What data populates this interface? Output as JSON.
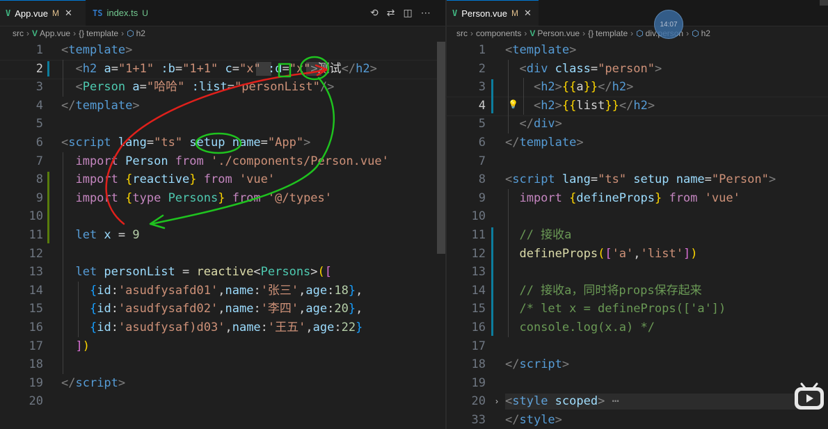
{
  "left": {
    "tabs": [
      {
        "icon": "V",
        "name": "App.vue",
        "mark": "M",
        "close": "✕",
        "active": true
      },
      {
        "icon": "TS",
        "name": "index.ts",
        "mark": "U",
        "active": false
      }
    ],
    "breadcrumb": [
      "src",
      "App.vue",
      "template",
      "h2"
    ],
    "lines": [
      {
        "n": "1",
        "t": [
          [
            "t-p",
            "<"
          ],
          [
            "t-tag",
            "template"
          ],
          [
            "t-p",
            ">"
          ]
        ]
      },
      {
        "n": "2",
        "cur": true,
        "t": [
          [
            "t-p",
            "  <"
          ],
          [
            "t-tag",
            "h2"
          ],
          [
            "",
            ""
          ],
          [
            "t-attr",
            " a"
          ],
          [
            "",
            "="
          ],
          [
            "t-str",
            "\"1+1\""
          ],
          [
            "t-attr",
            " :b"
          ],
          [
            "",
            "="
          ],
          [
            "t-str",
            "\"1+1\""
          ],
          [
            "t-attr",
            " c"
          ],
          [
            "",
            "="
          ],
          [
            "t-str",
            "\"x\""
          ],
          [
            "t-attr",
            " :d"
          ],
          [
            "",
            "="
          ],
          [
            "t-str",
            "\"x\""
          ],
          [
            "t-p",
            ">"
          ],
          [
            "",
            "测试"
          ],
          [
            "t-p",
            "</"
          ],
          [
            "t-tag",
            "h2"
          ],
          [
            "t-p",
            ">"
          ]
        ]
      },
      {
        "n": "3",
        "t": [
          [
            "t-p",
            "  <"
          ],
          [
            "t-comp",
            "Person"
          ],
          [
            "t-attr",
            " a"
          ],
          [
            "",
            "="
          ],
          [
            "t-str",
            "\"哈哈\""
          ],
          [
            "t-attr",
            " :list"
          ],
          [
            "",
            "="
          ],
          [
            "t-str",
            "\"personList\""
          ],
          [
            "t-p",
            "/>"
          ]
        ]
      },
      {
        "n": "4",
        "t": [
          [
            "t-p",
            "</"
          ],
          [
            "t-tag",
            "template"
          ],
          [
            "t-p",
            ">"
          ]
        ]
      },
      {
        "n": "5",
        "t": []
      },
      {
        "n": "6",
        "t": [
          [
            "t-p",
            "<"
          ],
          [
            "t-tag",
            "script"
          ],
          [
            "t-attr",
            " lang"
          ],
          [
            "",
            "="
          ],
          [
            "t-str",
            "\"ts\""
          ],
          [
            "t-attr",
            " setup"
          ],
          [
            "t-attr",
            " name"
          ],
          [
            "",
            "="
          ],
          [
            "t-str",
            "\"App\""
          ],
          [
            "t-p",
            ">"
          ]
        ]
      },
      {
        "n": "7",
        "t": [
          [
            "t-kw",
            "  import"
          ],
          [
            "",
            " "
          ],
          [
            "t-var",
            "Person"
          ],
          [
            "t-kw",
            " from"
          ],
          [
            "t-str",
            " './components/Person.vue'"
          ]
        ]
      },
      {
        "n": "8",
        "t": [
          [
            "t-kw",
            "  import"
          ],
          [
            "t-br1",
            " {"
          ],
          [
            "t-var",
            "reactive"
          ],
          [
            "t-br1",
            "}"
          ],
          [
            "t-kw",
            " from"
          ],
          [
            "t-str",
            " 'vue'"
          ]
        ]
      },
      {
        "n": "9",
        "t": [
          [
            "t-kw",
            "  import"
          ],
          [
            "t-br1",
            " {"
          ],
          [
            "t-kw",
            "type"
          ],
          [
            "t-comp",
            " Persons"
          ],
          [
            "t-br1",
            "}"
          ],
          [
            "t-kw",
            " from"
          ],
          [
            "t-str",
            " '@/types'"
          ]
        ]
      },
      {
        "n": "10",
        "t": []
      },
      {
        "n": "11",
        "t": [
          [
            "t-tag",
            "  let"
          ],
          [
            "t-var",
            " x"
          ],
          [
            "",
            " = "
          ],
          [
            "t-num",
            "9"
          ]
        ]
      },
      {
        "n": "12",
        "t": []
      },
      {
        "n": "13",
        "t": [
          [
            "t-tag",
            "  let"
          ],
          [
            "t-var",
            " personList"
          ],
          [
            "",
            " = "
          ],
          [
            "t-fn",
            "reactive"
          ],
          [
            "",
            "<"
          ],
          [
            "t-comp",
            "Persons"
          ],
          [
            "",
            ">"
          ],
          [
            "t-br1",
            "("
          ],
          [
            "t-br2",
            "["
          ]
        ]
      },
      {
        "n": "14",
        "t": [
          [
            "",
            "    "
          ],
          [
            "t-br3",
            "{"
          ],
          [
            "t-var",
            "id"
          ],
          [
            "",
            ":"
          ],
          [
            "t-str",
            "'asudfysafd01'"
          ],
          [
            "",
            ","
          ],
          [
            "t-var",
            "name"
          ],
          [
            "",
            ":"
          ],
          [
            "t-str",
            "'张三'"
          ],
          [
            "",
            ","
          ],
          [
            "t-var",
            "age"
          ],
          [
            "",
            ":"
          ],
          [
            "t-num",
            "18"
          ],
          [
            "t-br3",
            "}"
          ],
          [
            "",
            ","
          ]
        ]
      },
      {
        "n": "15",
        "t": [
          [
            "",
            "    "
          ],
          [
            "t-br3",
            "{"
          ],
          [
            "t-var",
            "id"
          ],
          [
            "",
            ":"
          ],
          [
            "t-str",
            "'asudfysafd02'"
          ],
          [
            "",
            ","
          ],
          [
            "t-var",
            "name"
          ],
          [
            "",
            ":"
          ],
          [
            "t-str",
            "'李四'"
          ],
          [
            "",
            ","
          ],
          [
            "t-var",
            "age"
          ],
          [
            "",
            ":"
          ],
          [
            "t-num",
            "20"
          ],
          [
            "t-br3",
            "}"
          ],
          [
            "",
            ","
          ]
        ]
      },
      {
        "n": "16",
        "t": [
          [
            "",
            "    "
          ],
          [
            "t-br3",
            "{"
          ],
          [
            "t-var",
            "id"
          ],
          [
            "",
            ":"
          ],
          [
            "t-str",
            "'asudfysaf)d03'"
          ],
          [
            "",
            ","
          ],
          [
            "t-var",
            "name"
          ],
          [
            "",
            ":"
          ],
          [
            "t-str",
            "'王五'"
          ],
          [
            "",
            ","
          ],
          [
            "t-var",
            "age"
          ],
          [
            "",
            ":"
          ],
          [
            "t-num",
            "22"
          ],
          [
            "t-br3",
            "}"
          ]
        ]
      },
      {
        "n": "17",
        "t": [
          [
            "t-br2",
            "  ]"
          ],
          [
            "t-br1",
            ")"
          ]
        ]
      },
      {
        "n": "18",
        "t": []
      },
      {
        "n": "19",
        "t": [
          [
            "t-p",
            "</"
          ],
          [
            "t-tag",
            "script"
          ],
          [
            "t-p",
            ">"
          ]
        ]
      },
      {
        "n": "20",
        "t": []
      }
    ]
  },
  "right": {
    "tabs": [
      {
        "icon": "V",
        "name": "Person.vue",
        "mark": "M",
        "close": "✕",
        "active": true
      }
    ],
    "breadcrumb": [
      "src",
      "components",
      "Person.vue",
      "template",
      "div.person",
      "h2"
    ],
    "clock": "14:07",
    "lines": [
      {
        "n": "1",
        "t": [
          [
            "t-p",
            "<"
          ],
          [
            "t-tag",
            "template"
          ],
          [
            "t-p",
            ">"
          ]
        ]
      },
      {
        "n": "2",
        "t": [
          [
            "t-p",
            "  <"
          ],
          [
            "t-tag",
            "div"
          ],
          [
            "t-attr",
            " class"
          ],
          [
            "",
            "="
          ],
          [
            "t-str",
            "\"person\""
          ],
          [
            "t-p",
            ">"
          ]
        ]
      },
      {
        "n": "3",
        "t": [
          [
            "t-p",
            "    <"
          ],
          [
            "t-tag",
            "h2"
          ],
          [
            "t-p",
            ">"
          ],
          [
            "t-br1",
            "{{"
          ],
          [
            "",
            "a"
          ],
          [
            "t-br1",
            "}}"
          ],
          [
            "t-p",
            "</"
          ],
          [
            "t-tag",
            "h2"
          ],
          [
            "t-p",
            ">"
          ]
        ]
      },
      {
        "n": "4",
        "cur": true,
        "t": [
          [
            "t-p",
            "    <"
          ],
          [
            "t-tag",
            "h2"
          ],
          [
            "t-p",
            ">"
          ],
          [
            "t-br1",
            "{{"
          ],
          [
            "",
            "list"
          ],
          [
            "t-br1",
            "}}"
          ],
          [
            "t-p",
            "</"
          ],
          [
            "t-tag",
            "h2"
          ],
          [
            "t-p",
            ">"
          ]
        ]
      },
      {
        "n": "5",
        "t": [
          [
            "t-p",
            "  </"
          ],
          [
            "t-tag",
            "div"
          ],
          [
            "t-p",
            ">"
          ]
        ]
      },
      {
        "n": "6",
        "t": [
          [
            "t-p",
            "</"
          ],
          [
            "t-tag",
            "template"
          ],
          [
            "t-p",
            ">"
          ]
        ]
      },
      {
        "n": "7",
        "t": []
      },
      {
        "n": "8",
        "t": [
          [
            "t-p",
            "<"
          ],
          [
            "t-tag",
            "script"
          ],
          [
            "t-attr",
            " lang"
          ],
          [
            "",
            "="
          ],
          [
            "t-str",
            "\"ts\""
          ],
          [
            "t-attr",
            " setup"
          ],
          [
            "t-attr",
            " name"
          ],
          [
            "",
            "="
          ],
          [
            "t-str",
            "\"Person\""
          ],
          [
            "t-p",
            ">"
          ]
        ]
      },
      {
        "n": "9",
        "t": [
          [
            "t-kw",
            "  import"
          ],
          [
            "t-br1",
            " {"
          ],
          [
            "t-var",
            "defineProps"
          ],
          [
            "t-br1",
            "}"
          ],
          [
            "t-kw",
            " from"
          ],
          [
            "t-str",
            " 'vue'"
          ]
        ]
      },
      {
        "n": "10",
        "t": []
      },
      {
        "n": "11",
        "t": [
          [
            "t-com",
            "  // 接收a"
          ]
        ]
      },
      {
        "n": "12",
        "t": [
          [
            "t-fn",
            "  defineProps"
          ],
          [
            "t-br1",
            "("
          ],
          [
            "t-br2",
            "["
          ],
          [
            "t-str",
            "'a'"
          ],
          [
            "",
            ","
          ],
          [
            "t-str",
            "'list'"
          ],
          [
            "t-br2",
            "]"
          ],
          [
            "t-br1",
            ")"
          ]
        ]
      },
      {
        "n": "13",
        "t": []
      },
      {
        "n": "14",
        "t": [
          [
            "t-com",
            "  // 接收a，同时将props保存起来"
          ]
        ]
      },
      {
        "n": "15",
        "t": [
          [
            "t-com",
            "  /* let x = defineProps(['a'])"
          ]
        ]
      },
      {
        "n": "16",
        "t": [
          [
            "t-com",
            "  console.log(x.a) */"
          ]
        ]
      },
      {
        "n": "17",
        "t": []
      },
      {
        "n": "18",
        "t": [
          [
            "t-p",
            "</"
          ],
          [
            "t-tag",
            "script"
          ],
          [
            "t-p",
            ">"
          ]
        ]
      },
      {
        "n": "19",
        "t": []
      },
      {
        "n": "20",
        "t": [
          [
            "t-p",
            "<"
          ],
          [
            "t-tag",
            "style"
          ],
          [
            "t-attr",
            " scoped"
          ],
          [
            "t-p",
            ">"
          ],
          [
            "t-p",
            " ⋯"
          ]
        ]
      },
      {
        "n": "33",
        "t": [
          [
            "t-p",
            "</"
          ],
          [
            "t-tag",
            "style"
          ],
          [
            "t-p",
            ">"
          ]
        ]
      }
    ]
  },
  "colors": {
    "accent": "#0078d4",
    "modified": "#e2c08d",
    "untracked": "#73c991",
    "vue": "#41b883",
    "ts": "#3178c6"
  }
}
